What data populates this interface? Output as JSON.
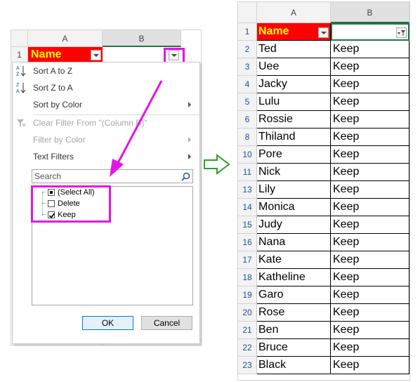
{
  "colors": {
    "header_fill": "#ff0000",
    "header_text": "#ffff00",
    "highlight": "#e614e6",
    "arrow": "#2ca02c",
    "filtered_row_number": "#1f4e9b"
  },
  "left": {
    "col_headers": [
      "A",
      "B"
    ],
    "row_number": "1",
    "header_cell": "Name",
    "menu": {
      "items": [
        {
          "label": "Sort A to Z",
          "icon": "sort-az-icon",
          "enabled": true,
          "submenu": false
        },
        {
          "label": "Sort Z to A",
          "icon": "sort-za-icon",
          "enabled": true,
          "submenu": false
        },
        {
          "label": "Sort by Color",
          "enabled": true,
          "submenu": true
        },
        {
          "label": "Clear Filter From \"(Column B)\"",
          "icon": "clear-filter-icon",
          "enabled": false,
          "submenu": false
        },
        {
          "label": "Filter by Color",
          "enabled": false,
          "submenu": true
        },
        {
          "label": "Text Filters",
          "enabled": true,
          "submenu": true
        }
      ],
      "search_placeholder": "Search",
      "list": [
        {
          "label": "(Select All)",
          "state": "partial"
        },
        {
          "label": "Delete",
          "state": "unchecked"
        },
        {
          "label": "Keep",
          "state": "checked"
        }
      ],
      "ok_label": "OK",
      "cancel_label": "Cancel"
    }
  },
  "right": {
    "col_headers": [
      "A",
      "B"
    ],
    "header_row": {
      "num": "1",
      "a": "Name",
      "b": ""
    },
    "rows": [
      {
        "num": "2",
        "a": "Ted",
        "b": "Keep"
      },
      {
        "num": "3",
        "a": "Uee",
        "b": "Keep"
      },
      {
        "num": "4",
        "a": "Jacky",
        "b": "Keep"
      },
      {
        "num": "5",
        "a": "Lulu",
        "b": "Keep"
      },
      {
        "num": "6",
        "a": "Rossie",
        "b": "Keep"
      },
      {
        "num": "8",
        "a": "Thiland",
        "b": "Keep"
      },
      {
        "num": "10",
        "a": "Pore",
        "b": "Keep"
      },
      {
        "num": "11",
        "a": "Nick",
        "b": "Keep"
      },
      {
        "num": "13",
        "a": "Lily",
        "b": "Keep"
      },
      {
        "num": "14",
        "a": "Monica",
        "b": "Keep"
      },
      {
        "num": "15",
        "a": "Judy",
        "b": "Keep"
      },
      {
        "num": "16",
        "a": "Nana",
        "b": "Keep"
      },
      {
        "num": "17",
        "a": "Kate",
        "b": "Keep"
      },
      {
        "num": "18",
        "a": "Katheline",
        "b": "Keep"
      },
      {
        "num": "19",
        "a": "Garo",
        "b": "Keep"
      },
      {
        "num": "20",
        "a": "Rose",
        "b": "Keep"
      },
      {
        "num": "21",
        "a": "Ben",
        "b": "Keep"
      },
      {
        "num": "22",
        "a": "Bruce",
        "b": "Keep"
      },
      {
        "num": "23",
        "a": "Black",
        "b": "Keep"
      }
    ]
  }
}
